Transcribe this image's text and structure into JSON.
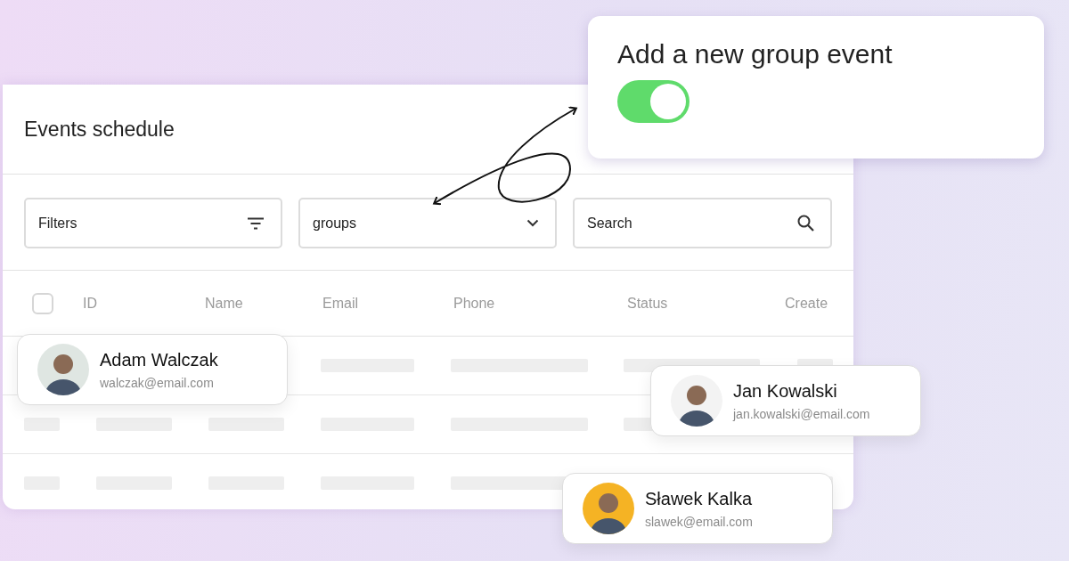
{
  "panel": {
    "title": "Events schedule",
    "filters": {
      "label": "Filters"
    },
    "group_select": {
      "value": "groups"
    },
    "search": {
      "placeholder": "Search"
    },
    "table": {
      "select_all": {
        "checked": false
      },
      "columns": [
        "ID",
        "Name",
        "Email",
        "Phone",
        "Status",
        "Create"
      ]
    }
  },
  "group_event": {
    "title": "Add a new group event",
    "toggle": {
      "on": true
    }
  },
  "people": [
    {
      "name": "Adam Walczak",
      "email": "walczak@email.com"
    },
    {
      "name": "Jan Kowalski",
      "email": "jan.kowalski@email.com"
    },
    {
      "name": "Sławek Kalka",
      "email": "slawek@email.com"
    }
  ]
}
